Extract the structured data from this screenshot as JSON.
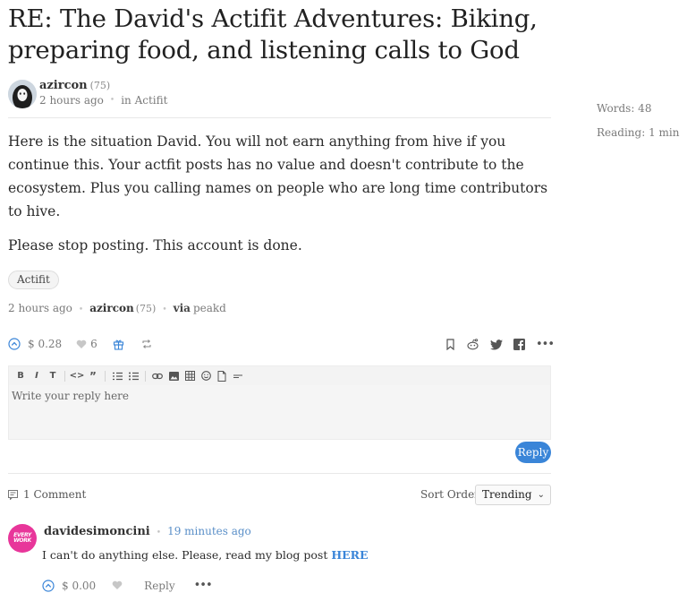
{
  "post": {
    "title": "RE: The David's Actifit Adventures: Biking, preparing food, and listening calls to God",
    "author": "azircon",
    "reputation": "(75)",
    "time": "2 hours ago",
    "dot": "•",
    "community": "in Actifit",
    "paragraphs": [
      "Here is the situation David. You will not earn anything from hive if you continue this. Your actfit posts has no value and doesn't contribute to the ecosystem. Plus you calling names on people who are long time contributors to hive.",
      "Please stop posting. This account is done."
    ],
    "tag": "Actifit",
    "footer_time": "2 hours ago",
    "footer_author": "azircon",
    "footer_rep": "(75)",
    "via_label": "via",
    "via_app": "peakd"
  },
  "stats": {
    "words": "Words: 48",
    "reading": "Reading: 1 min"
  },
  "actions": {
    "payout": "$ 0.28",
    "votes": "6"
  },
  "editor": {
    "placeholder": "Write your reply here",
    "reply_label": "Reply"
  },
  "comments": {
    "count_label": "1 Comment",
    "sort_label": "Sort Order",
    "sort_value": "Trending",
    "items": [
      {
        "author": "davidesimoncini",
        "time": "19 minutes ago",
        "text": "I can't do anything else. Please, read my blog post ",
        "link_text": "HERE",
        "payout": "$ 0.00",
        "reply_label": "Reply",
        "avatar_text": "EVERY WORK"
      }
    ]
  },
  "colors": {
    "accent": "#3a85d8",
    "muted": "#7a7a7a",
    "avatar_pink": "#e8369a"
  },
  "icons": [
    "upvote-icon",
    "heart-icon",
    "gift-icon",
    "reblog-icon",
    "bookmark-icon",
    "reddit-icon",
    "twitter-icon",
    "facebook-icon",
    "more-icon",
    "comment-icon"
  ]
}
